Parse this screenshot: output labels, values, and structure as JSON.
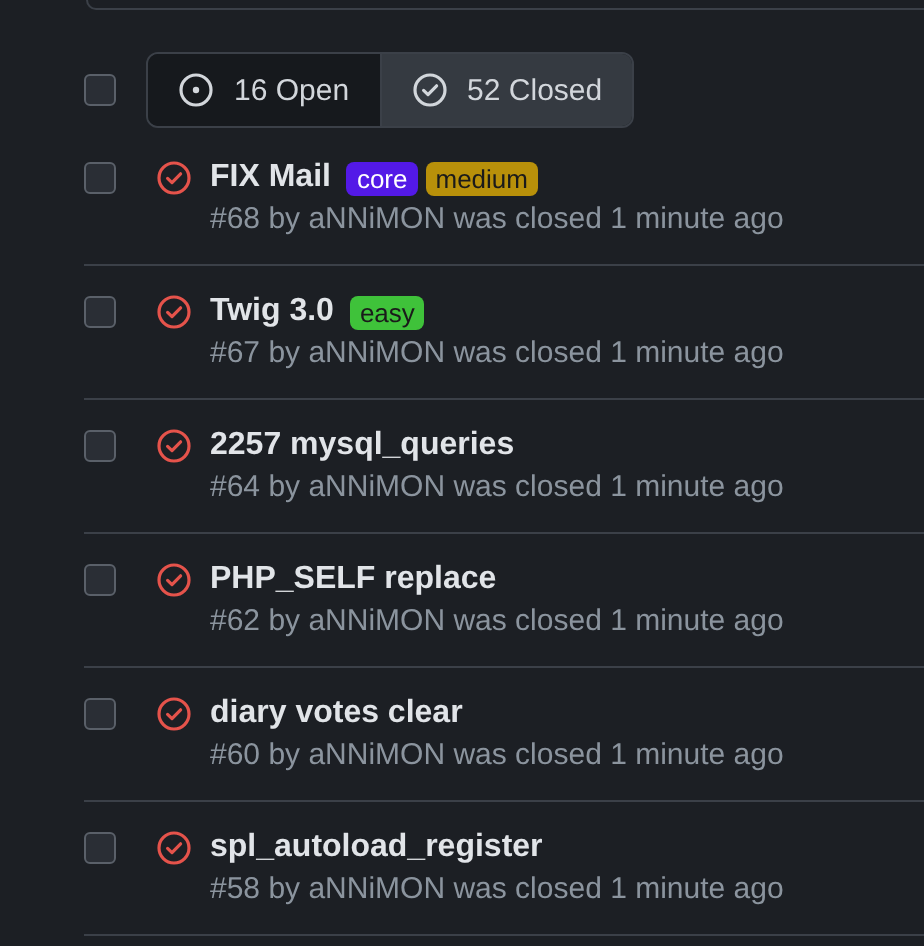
{
  "select_all": {
    "checked": false
  },
  "filter_tabs": [
    {
      "label": "16 Open",
      "kind": "open",
      "selected": false
    },
    {
      "label": "52 Closed",
      "kind": "closed",
      "selected": true
    }
  ],
  "issues": [
    {
      "title": "FIX Mail",
      "checked": false,
      "labels": [
        {
          "name": "core",
          "color": "#5319e7"
        },
        {
          "name": "medium",
          "color": "#b8900a"
        }
      ],
      "meta": "#68 by aNNiMON was closed 1 minute ago"
    },
    {
      "title": "Twig 3.0",
      "checked": false,
      "labels": [
        {
          "name": "easy",
          "color": "#3fc23a"
        }
      ],
      "meta": "#67 by aNNiMON was closed 1 minute ago"
    },
    {
      "title": "2257 mysql_queries",
      "checked": false,
      "meta": "#64 by aNNiMON was closed 1 minute ago"
    },
    {
      "title": "PHP_SELF replace",
      "checked": false,
      "meta": "#62 by aNNiMON was closed 1 minute ago"
    },
    {
      "title": "diary votes clear",
      "checked": false,
      "meta": "#60 by aNNiMON was closed 1 minute ago"
    },
    {
      "title": "spl_autoload_register",
      "checked": false,
      "meta": "#58 by aNNiMON was closed 1 minute ago"
    }
  ]
}
